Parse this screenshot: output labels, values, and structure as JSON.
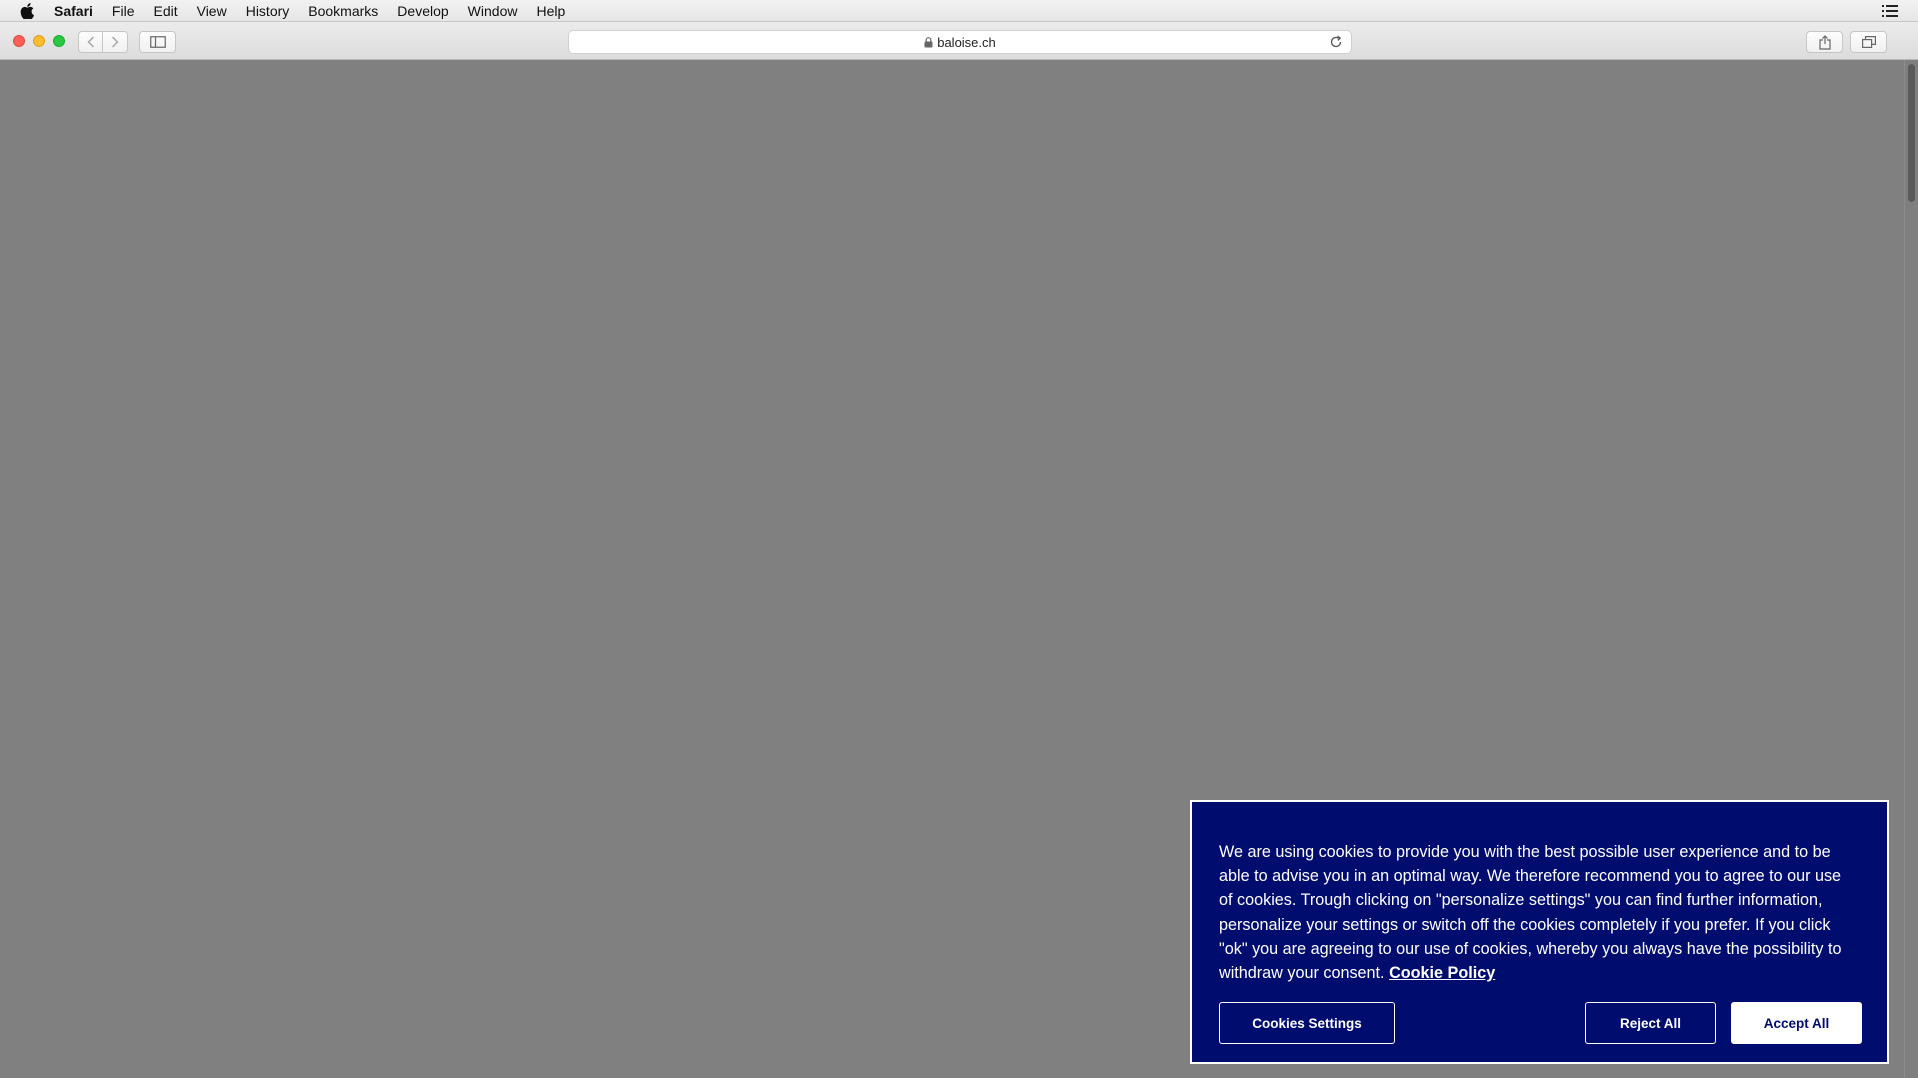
{
  "menubar": {
    "app_name": "Safari",
    "items": [
      "File",
      "Edit",
      "View",
      "History",
      "Bookmarks",
      "Develop",
      "Window",
      "Help"
    ]
  },
  "toolbar": {
    "url": "baloise.ch"
  },
  "cookie_banner": {
    "text": "We are using cookies to provide you with the best possible user experience and to be able to advise you in an optimal way. We therefore recommend you to agree to our use of cookies. Trough clicking on \"personalize settings\" you can find further information, personalize your settings or switch off the cookies completely if you prefer. If you click \"ok\" you are agreeing to our use of cookies, whereby you always have the possibility to withdraw your consent.",
    "policy_link": "Cookie Policy",
    "settings_button": "Cookies Settings",
    "reject_button": "Reject All",
    "accept_button": "Accept All"
  },
  "colors": {
    "banner_background": "#000d6e",
    "page_overlay": "#808080"
  }
}
